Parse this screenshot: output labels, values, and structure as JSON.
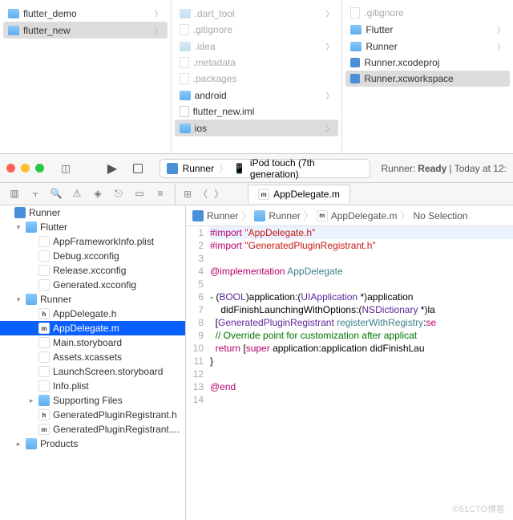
{
  "finder": {
    "col1": [
      {
        "name": "flutter_demo",
        "type": "folder",
        "dim": false,
        "sel": false,
        "chev": true
      },
      {
        "name": "flutter_new",
        "type": "folder",
        "dim": false,
        "sel": true,
        "chev": true
      }
    ],
    "col2": [
      {
        "name": ".dart_tool",
        "type": "folder",
        "dim": true,
        "chev": true
      },
      {
        "name": ".gitignore",
        "type": "file",
        "dim": true
      },
      {
        "name": ".idea",
        "type": "folder",
        "dim": true,
        "chev": true
      },
      {
        "name": ".metadata",
        "type": "file",
        "dim": true
      },
      {
        "name": ".packages",
        "type": "file",
        "dim": true
      },
      {
        "name": "android",
        "type": "folder",
        "dim": false,
        "chev": true
      },
      {
        "name": "flutter_new.iml",
        "type": "file",
        "dim": false
      },
      {
        "name": "ios",
        "type": "folder",
        "dim": false,
        "sel": true,
        "chev": true
      }
    ],
    "col3": [
      {
        "name": ".gitignore",
        "type": "file",
        "dim": true
      },
      {
        "name": "Flutter",
        "type": "folder",
        "dim": false,
        "chev": true
      },
      {
        "name": "Runner",
        "type": "folder",
        "dim": false,
        "chev": true
      },
      {
        "name": "Runner.xcodeproj",
        "type": "xcode",
        "dim": false
      },
      {
        "name": "Runner.xcworkspace",
        "type": "xcode",
        "dim": false,
        "sel": true
      }
    ]
  },
  "toolbar": {
    "scheme_app": "Runner",
    "scheme_device": "iPod touch (7th generation)",
    "status_prefix": "Runner:",
    "status_state": "Ready",
    "status_time": "Today at 12:"
  },
  "tab": {
    "label": "AppDelegate.m"
  },
  "jumpbar": {
    "p0": "Runner",
    "p1": "Runner",
    "p2": "AppDelegate.m",
    "p3": "No Selection"
  },
  "sidebar": {
    "root": "Runner",
    "flutter_group": "Flutter",
    "flutter_items": [
      "AppFrameworkInfo.plist",
      "Debug.xcconfig",
      "Release.xcconfig",
      "Generated.xcconfig"
    ],
    "runner_group": "Runner",
    "runner_items": [
      "AppDelegate.h",
      "AppDelegate.m",
      "Main.storyboard",
      "Assets.xcassets",
      "LaunchScreen.storyboard",
      "Info.plist"
    ],
    "supporting": "Supporting Files",
    "extra": [
      "GeneratedPluginRegistrant.h",
      "GeneratedPluginRegistrant...."
    ],
    "products": "Products"
  },
  "code": {
    "lines": [
      {
        "n": 1,
        "html": "<span class='decl'>#import</span> <span class='str'>\"AppDelegate.h\"</span>",
        "hl": true
      },
      {
        "n": 2,
        "html": "<span class='decl'>#import</span> <span class='str'>\"GeneratedPluginRegistrant.h\"</span>"
      },
      {
        "n": 3,
        "html": ""
      },
      {
        "n": 4,
        "html": "<span class='kw'>@implementation</span> <span class='cls'>AppDelegate</span>"
      },
      {
        "n": 5,
        "html": ""
      },
      {
        "n": 6,
        "html": "- (<span class='type'>BOOL</span>)application:(<span class='type'>UIApplication</span> *)application"
      },
      {
        "n": 7,
        "html": "    didFinishLaunchingWithOptions:(<span class='type'>NSDictionary</span> *)la"
      },
      {
        "n": 8,
        "html": "  [<span class='type'>GeneratedPluginRegistrant</span> <span class='cls'>registerWithRegistry</span>:<span class='kw'>se</span>"
      },
      {
        "n": 9,
        "html": "  <span class='cmt'>// Override point for customization after applicat</span>"
      },
      {
        "n": 10,
        "html": "  <span class='kw'>return</span> [<span class='kw'>super</span> application:application didFinishLau"
      },
      {
        "n": 11,
        "html": "}"
      },
      {
        "n": 12,
        "html": ""
      },
      {
        "n": 13,
        "html": "<span class='kw'>@end</span>"
      },
      {
        "n": 14,
        "html": ""
      }
    ]
  },
  "watermark": "©51CTO博客"
}
